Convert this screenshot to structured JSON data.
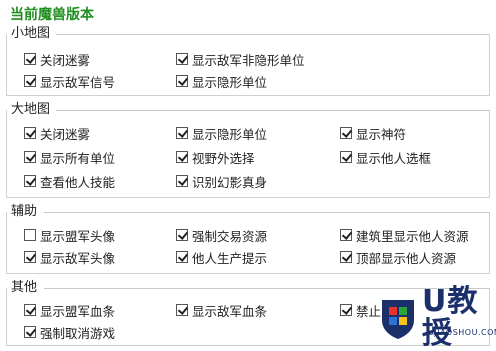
{
  "title": "当前魔兽版本",
  "groups": [
    {
      "label": "小地图",
      "items": [
        {
          "label": "关闭迷雾",
          "checked": true
        },
        {
          "label": "显示敌军非隐形单位",
          "checked": true
        },
        {
          "label": "显示敌军信号",
          "checked": true
        },
        {
          "label": "显示隐形单位",
          "checked": true
        }
      ]
    },
    {
      "label": "大地图",
      "items": [
        {
          "label": "关闭迷雾",
          "checked": true
        },
        {
          "label": "显示隐形单位",
          "checked": true
        },
        {
          "label": "显示神符",
          "checked": true
        },
        {
          "label": "显示所有单位",
          "checked": true
        },
        {
          "label": "视野外选择",
          "checked": true
        },
        {
          "label": "显示他人选框",
          "checked": true
        },
        {
          "label": "查看他人技能",
          "checked": true
        },
        {
          "label": "识别幻影真身",
          "checked": true
        }
      ]
    },
    {
      "label": "辅助",
      "items": [
        {
          "label": "显示盟军头像",
          "checked": false
        },
        {
          "label": "强制交易资源",
          "checked": true
        },
        {
          "label": "建筑里显示他人资源",
          "checked": true
        },
        {
          "label": "显示敌军头像",
          "checked": true
        },
        {
          "label": "他人生产提示",
          "checked": true
        },
        {
          "label": "顶部显示他人资源",
          "checked": true
        }
      ]
    },
    {
      "label": "其他",
      "items": [
        {
          "label": "显示盟军血条",
          "checked": true
        },
        {
          "label": "显示敌军血条",
          "checked": true
        },
        {
          "label": "禁止",
          "checked": true
        },
        {
          "label": "强制取消游戏",
          "checked": true
        }
      ]
    }
  ],
  "watermark": {
    "main": "U教授",
    "sub": "UJIAOSHOU.COM",
    "colors": {
      "shield": "#1b2f6b",
      "accent": "#e8312a",
      "green": "#2aa53a",
      "yellow": "#f4c21b",
      "blue": "#2a74d6"
    }
  }
}
